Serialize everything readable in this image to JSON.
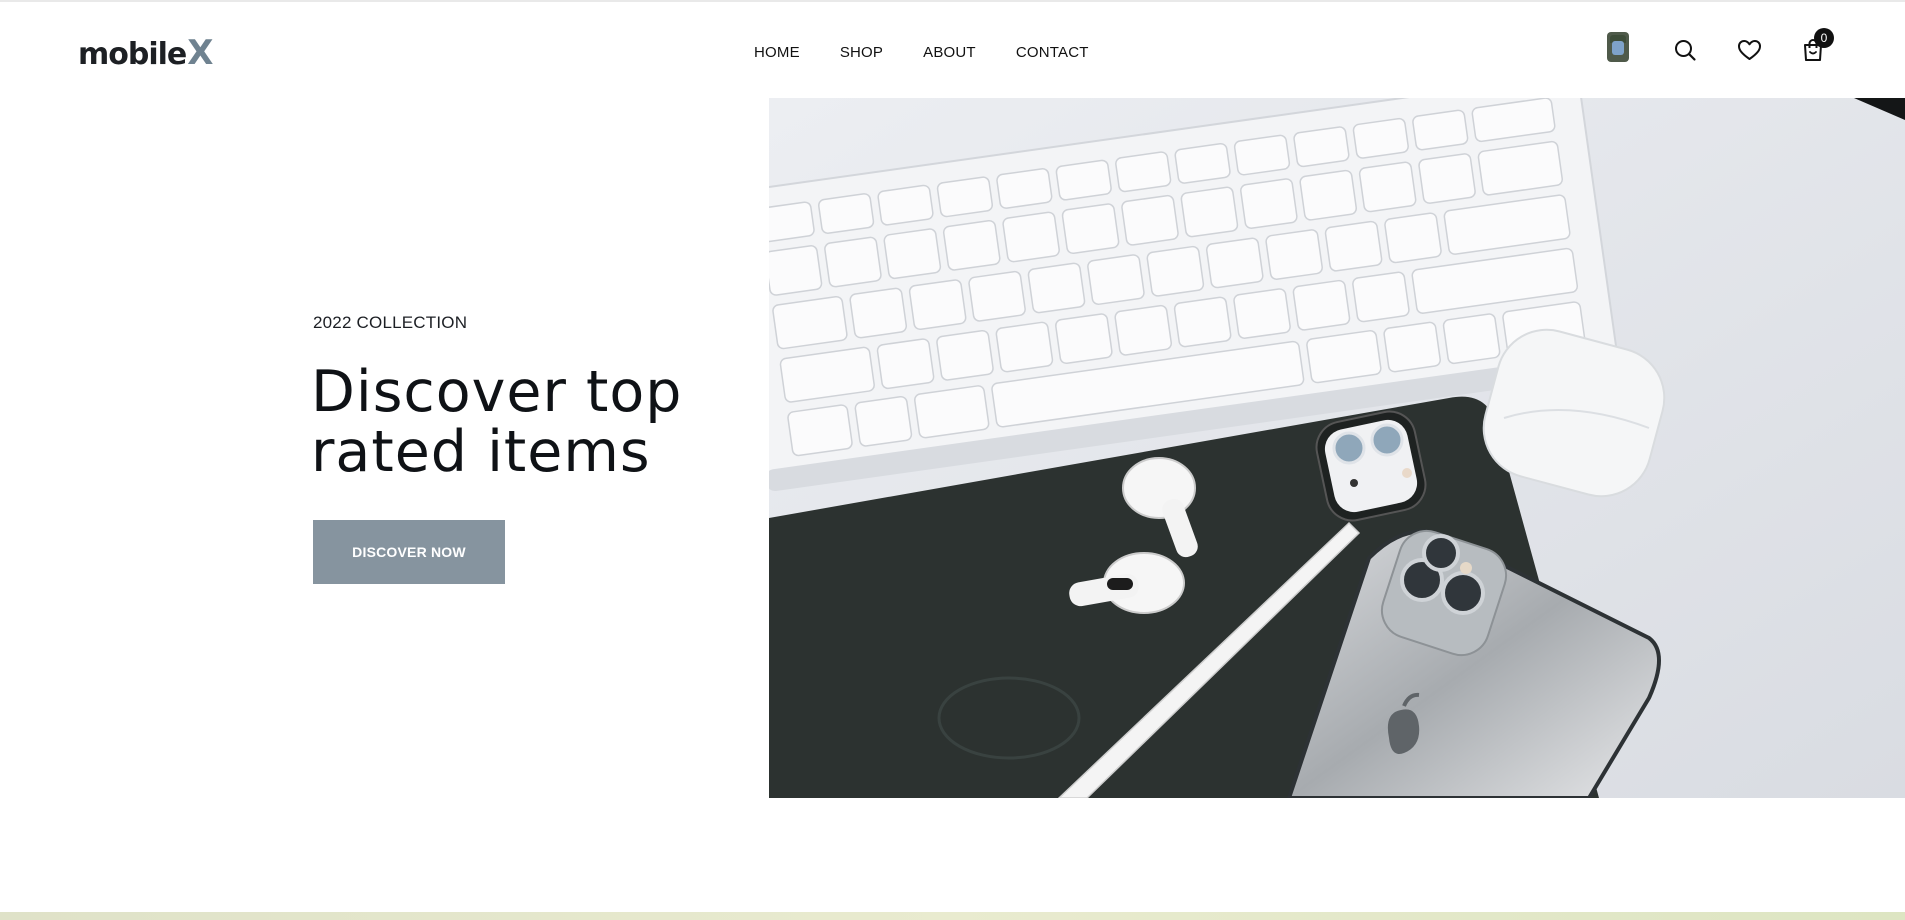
{
  "brand": {
    "logo_text": "mobile",
    "logo_mark": "X"
  },
  "nav": {
    "items": [
      {
        "label": "HOME"
      },
      {
        "label": "SHOP"
      },
      {
        "label": "ABOUT"
      },
      {
        "label": "CONTACT"
      }
    ]
  },
  "header_actions": {
    "avatar_icon": "user-avatar",
    "search_icon": "search-icon",
    "wishlist_icon": "heart-icon",
    "cart_icon": "shopping-bag-icon",
    "cart_count": "0"
  },
  "hero": {
    "subtitle": "2022 COLLECTION",
    "headline_line1": "Discover top",
    "headline_line2": "rated items",
    "cta_label": "DISCOVER NOW"
  },
  "colors": {
    "accent": "#86949f",
    "logo_mark": "#6f8290",
    "text": "#111111",
    "background": "#ffffff"
  }
}
